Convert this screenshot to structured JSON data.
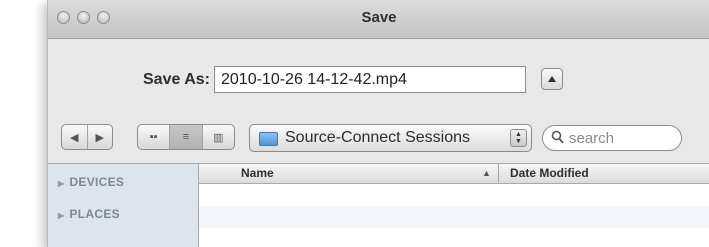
{
  "window": {
    "title": "Save"
  },
  "save_as": {
    "label": "Save As:",
    "filename": "2010-10-26 14-12-42.mp4"
  },
  "toolbar": {
    "back_glyph": "◀",
    "forward_glyph": "▶",
    "view_icons_glyph": "▪▪",
    "view_list_glyph": "≡",
    "view_columns_glyph": "▥"
  },
  "location": {
    "folder": "Source-Connect Sessions"
  },
  "search": {
    "placeholder": "search"
  },
  "sidebar": {
    "items": [
      {
        "label": "DEVICES"
      },
      {
        "label": "PLACES"
      }
    ]
  },
  "file_list": {
    "columns": [
      {
        "label": "Name"
      },
      {
        "label": "Date Modified"
      }
    ]
  }
}
